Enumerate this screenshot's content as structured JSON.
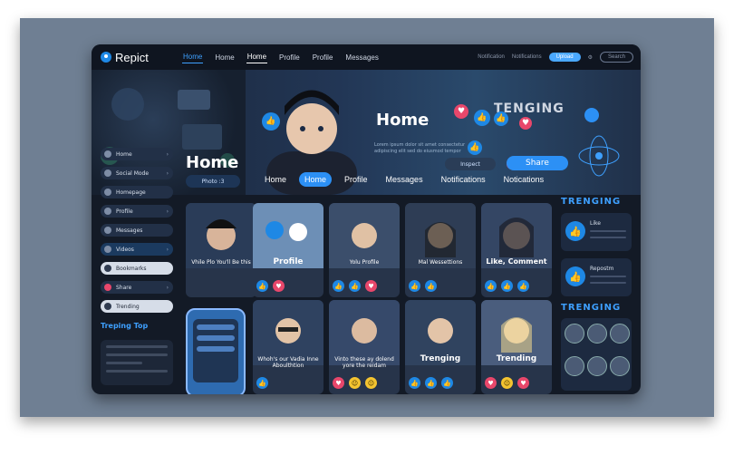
{
  "colors": {
    "accent": "#2c90f5",
    "like": "#1e88e5",
    "heart": "#e8476b",
    "bg": "#131a26"
  },
  "topbar": {
    "brand": "Repict",
    "nav": [
      "Home",
      "Home",
      "Home",
      "Profile",
      "Profile",
      "Messages"
    ],
    "right_items": [
      "Notification",
      "Notifications"
    ],
    "pill": "Upload",
    "search": "Search"
  },
  "hero": {
    "title": "Home",
    "side_title": "TENGING",
    "text": "Lorem ipsum dolor sit amet consectetur adipiscing elit sed do eiusmod tempor",
    "sub_title": "Home",
    "action1": "Photo :3",
    "action2": "Inspect",
    "share": "Share"
  },
  "tabs": [
    "Home",
    "Home",
    "Profile",
    "Messages",
    "Notifications",
    "Notications"
  ],
  "sidebar": {
    "items": [
      {
        "label": "Home",
        "icon": "home-icon"
      },
      {
        "label": "Social Mode",
        "icon": "globe-icon"
      },
      {
        "label": "Homepage",
        "icon": "user-icon"
      },
      {
        "label": "Profile",
        "icon": "profile-icon"
      },
      {
        "label": "Messages",
        "icon": "message-icon"
      },
      {
        "label": "Videos",
        "icon": "video-icon"
      },
      {
        "label": "Bookmarks",
        "icon": "bookmark-icon"
      },
      {
        "label": "Share",
        "icon": "heart-icon"
      },
      {
        "label": "Trending",
        "icon": "trend-icon"
      }
    ],
    "trending_title": "Treping Top"
  },
  "cards": [
    {
      "title": "Vhile Plo You'll Be this",
      "style": "small"
    },
    {
      "title": "Profile",
      "style": "small"
    },
    {
      "title": "Yolu Profile",
      "style": "small"
    },
    {
      "title": "Mal Wessettions",
      "style": "small"
    },
    {
      "title": "Like, Comment",
      "style": "small"
    },
    {
      "title": "Whoh's our Vadia Inne Aboulthtion",
      "style": "small"
    },
    {
      "title": "Vinto these ay dolend yore the reidam",
      "style": "small"
    },
    {
      "title": "Trenging",
      "style": "big"
    },
    {
      "title": "Trending",
      "style": "big"
    }
  ],
  "right": {
    "title1": "TRENGING",
    "card1_label": "Like",
    "card2_label": "Repostm",
    "title2": "TRENGING"
  }
}
